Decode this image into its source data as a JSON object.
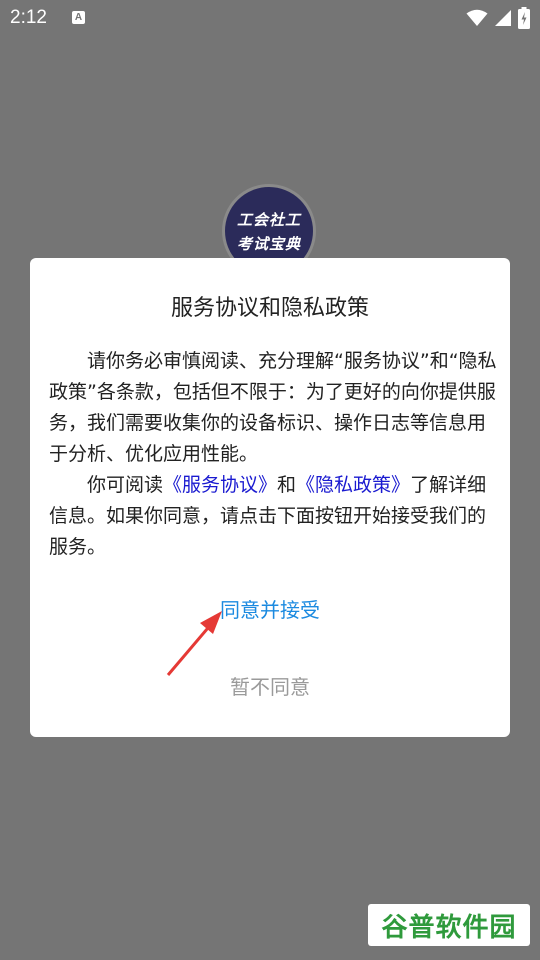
{
  "status_bar": {
    "time": "2:12",
    "notification_icon_letter": "A",
    "icons": [
      "wifi-icon",
      "signal-icon",
      "battery-charging-icon"
    ]
  },
  "logo": {
    "line1": "工会社工",
    "line2": "考试宝典"
  },
  "dialog": {
    "title": "服务协议和隐私政策",
    "paragraph1": "请你务必审慎阅读、充分理解“服务协议”和“隐私政策”各条款，包括但不限于：为了更好的向你提供服务，我们需要收集你的设备标识、操作日志等信息用于分析、优化应用性能。",
    "paragraph2_prefix": "你可阅读",
    "service_agreement_link": "《服务协议》",
    "paragraph2_and": "和",
    "privacy_policy_link": "《隐私政策》",
    "paragraph2_suffix": "了解详细信息。如果你同意，请点击下面按钮开始接受我们的服务。",
    "accept_label": "同意并接受",
    "decline_label": "暂不同意"
  },
  "colors": {
    "overlay": "#757575",
    "link": "#1a1ad0",
    "accept": "#1b8ae0",
    "arrow": "#e53935",
    "watermark": "#2f9a3c"
  },
  "watermark": {
    "text": "谷普软件园"
  }
}
